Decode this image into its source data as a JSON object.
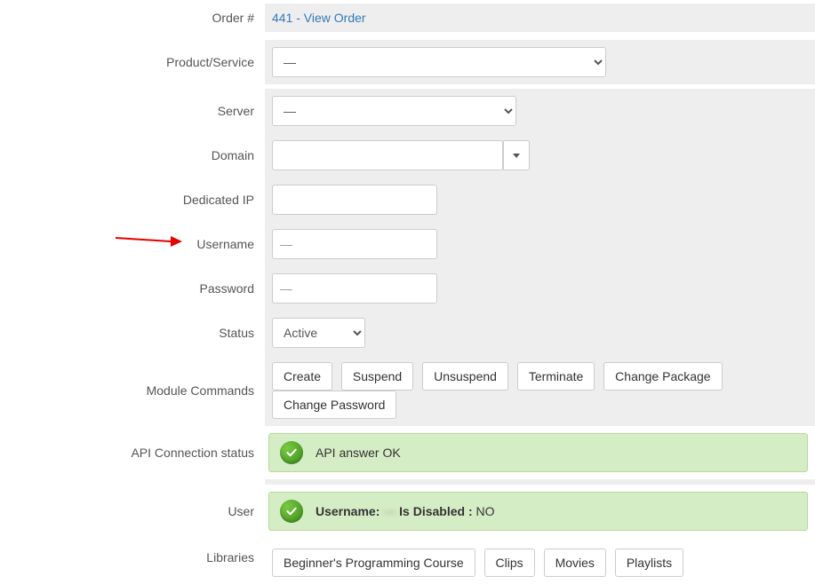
{
  "labels": {
    "order": "Order #",
    "product": "Product/Service",
    "server": "Server",
    "domain": "Domain",
    "dedicated_ip": "Dedicated IP",
    "username": "Username",
    "password": "Password",
    "status": "Status",
    "module_commands": "Module Commands",
    "api_status": "API Connection status",
    "user": "User",
    "libraries": "Libraries"
  },
  "values": {
    "order_text": "441 - View Order",
    "product_value": "—",
    "server_value": "—",
    "domain_value": "",
    "dedicated_ip_value": "",
    "username_value": "—",
    "password_value": "—",
    "status_value": "Active",
    "api_status_text": "API answer OK",
    "user_username_label": "Username:",
    "user_username_value": "—",
    "user_disabled_label": "Is Disabled :",
    "user_disabled_value": "NO"
  },
  "buttons": {
    "create": "Create",
    "suspend": "Suspend",
    "unsuspend": "Unsuspend",
    "terminate": "Terminate",
    "change_package": "Change Package",
    "change_password": "Change Password",
    "lib1": "Beginner's Programming Course",
    "lib2": "Clips",
    "lib3": "Movies",
    "lib4": "Playlists"
  }
}
